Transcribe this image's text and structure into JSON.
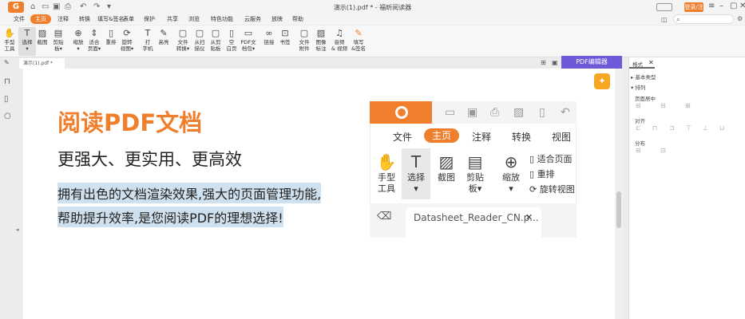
{
  "title_bar": {
    "logo": "G",
    "title": "演示(1).pdf * - 福昕阅读器",
    "login": "登录/注册",
    "quick_icons": [
      "home-icon",
      "folder-icon",
      "save-icon",
      "print-icon",
      "undo-icon",
      "redo-icon",
      "dropdown-icon"
    ]
  },
  "menu": {
    "items": [
      "文件",
      "主页",
      "注释",
      "转换",
      "填写&签名",
      "表单",
      "保护",
      "共享",
      "浏览",
      "特色功能",
      "云服务",
      "放映",
      "帮助"
    ],
    "active": "主页"
  },
  "ribbon": {
    "tools": [
      {
        "icon": "hand-icon",
        "label": "手型\n工具"
      },
      {
        "icon": "select-text-icon",
        "label": "选择\n▾"
      },
      {
        "icon": "screenshot-icon",
        "label": "截图"
      },
      {
        "icon": "clipboard-icon",
        "label": "剪贴\n板▾"
      },
      {
        "icon": "zoom-icon",
        "label": "缩放\n▾"
      },
      {
        "icon": "fit-page-icon",
        "label": "适合\n页面▾"
      },
      {
        "icon": "rotate-icon",
        "label": "重排"
      },
      {
        "icon": "rotate-view-icon",
        "label": "旋转\n视图▾"
      },
      {
        "icon": "typewriter-icon",
        "label": "打\n字机"
      },
      {
        "icon": "highlight-icon",
        "label": "高亮"
      },
      {
        "icon": "file-convert-icon",
        "label": "文件\n转换▾"
      },
      {
        "icon": "scan-icon",
        "label": "从扫\n描仪"
      },
      {
        "icon": "clipboard-create-icon",
        "label": "从剪\n贴板"
      },
      {
        "icon": "blank-icon",
        "label": "空\n白页"
      },
      {
        "icon": "pdf-doc-icon",
        "label": "PDF文\n档包▾"
      },
      {
        "icon": "link-icon",
        "label": "链接"
      },
      {
        "icon": "bookmark-icon",
        "label": "书签"
      },
      {
        "icon": "attachment-icon",
        "label": "文件\n附件"
      },
      {
        "icon": "image-icon",
        "label": "图像\n标注"
      },
      {
        "icon": "audio-video-icon",
        "label": "音频\n& 视频"
      },
      {
        "icon": "sign-icon",
        "label": "填写\n&签名"
      }
    ]
  },
  "tabs": {
    "doc_tab": "演示(1).pdf *",
    "pdf_edit_button": "PDF编辑器"
  },
  "right_panel": {
    "title": "格式",
    "section1": "基本类型",
    "section2": "排列",
    "page_center": "页面居中",
    "align": "对齐",
    "distribute": "分布"
  },
  "content": {
    "heading": "阅读PDF文档",
    "subheading": "更强大、更实用、更高效",
    "line1": "拥有出色的文档渲染效果,强大的页面管理功能,",
    "line2": "帮助提升效率,是您阅读PDF的理想选择!"
  },
  "mock": {
    "tabs": [
      "文件",
      "主页",
      "注释",
      "转换",
      "视图"
    ],
    "tools": [
      {
        "icon": "hand-icon",
        "label": "手型\n工具"
      },
      {
        "icon": "select-text-icon",
        "label": "选择\n▾"
      },
      {
        "icon": "screenshot-icon",
        "label": "截图"
      },
      {
        "icon": "clipboard-icon",
        "label": "剪贴\n板▾"
      },
      {
        "icon": "zoom-icon",
        "label": "缩放\n▾"
      }
    ],
    "side_tools": [
      "适合页面",
      "重排",
      "旋转视图"
    ],
    "doc_tab": "Datasheet_Reader_CN.p..."
  },
  "colors": {
    "accent": "#f07f2d",
    "pdf_edit": "#6e5ad9",
    "highlight": "#cfe0ee"
  }
}
